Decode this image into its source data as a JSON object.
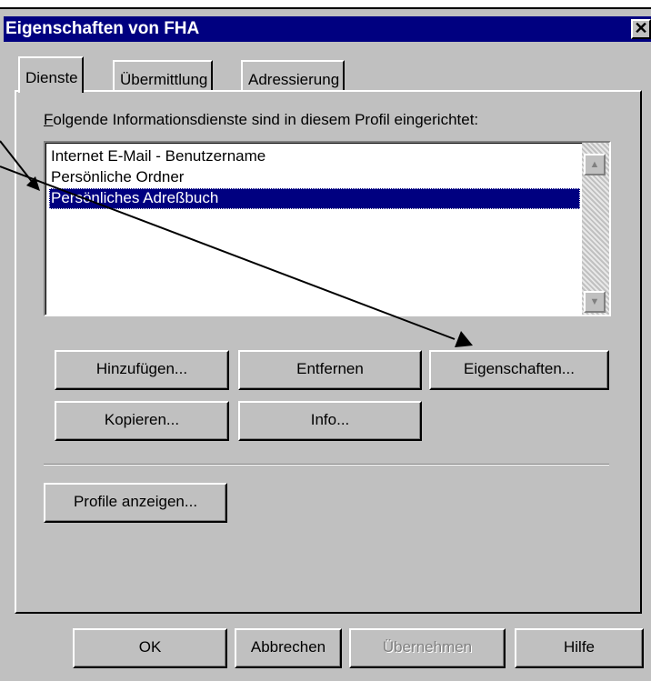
{
  "window": {
    "title": "Eigenschaften von FHA",
    "close_glyph": "✕"
  },
  "tabs": [
    {
      "label": "Dienste",
      "active": true
    },
    {
      "label": "Übermittlung",
      "active": false
    },
    {
      "label": "Adressierung",
      "active": false
    }
  ],
  "services": {
    "label_prefix": "F",
    "label_rest": "olgende Informationsdienste sind in diesem Profil eingerichtet:",
    "items": [
      "Internet E-Mail - Benutzername",
      "Persönliche Ordner",
      "Persönliches Adreßbuch"
    ],
    "selected_index": 2
  },
  "buttons": {
    "add": "Hinzufügen...",
    "remove": "Entfernen",
    "properties": "Eigenschaften...",
    "copy": "Kopieren...",
    "info": "Info...",
    "show_profiles": "Profile anzeigen..."
  },
  "footer": {
    "ok": "OK",
    "cancel": "Abbrechen",
    "apply": "Übernehmen",
    "help": "Hilfe"
  },
  "colors": {
    "titlebar": "#000080",
    "face": "#c0c0c0",
    "selection": "#000080"
  }
}
